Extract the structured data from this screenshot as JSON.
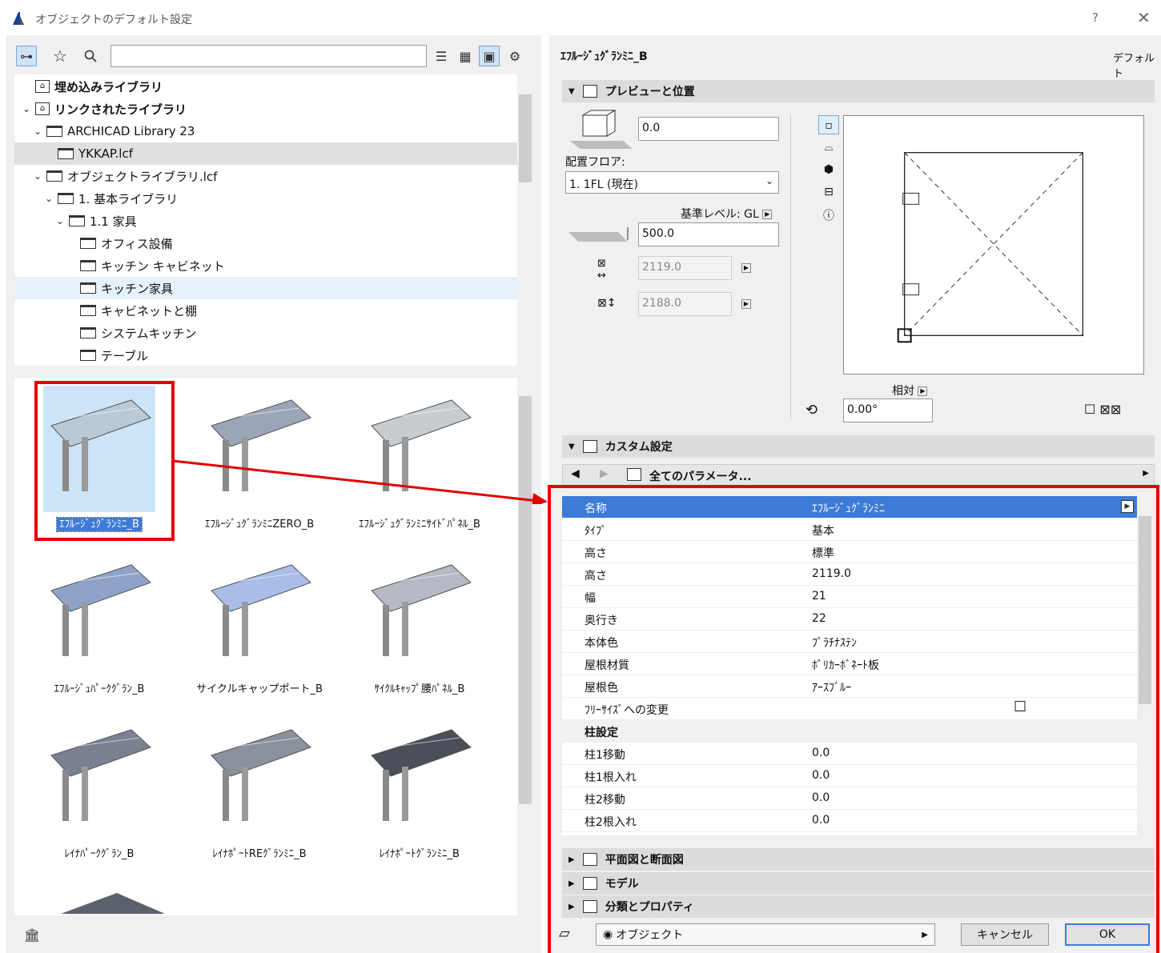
{
  "window": {
    "title": "オブジェクトのデフォルト設定",
    "help": "?",
    "close": "✕"
  },
  "search": {
    "value": "",
    "placeholder": ""
  },
  "tree": [
    {
      "label": "埋め込みライブラリ",
      "indent": 0,
      "chev": "",
      "icon": "lib",
      "bold": true
    },
    {
      "label": "リンクされたライブラリ",
      "indent": 0,
      "chev": "⌄",
      "icon": "lib",
      "bold": true
    },
    {
      "label": "ARCHICAD Library 23",
      "indent": 1,
      "chev": "⌄",
      "icon": "folder"
    },
    {
      "label": "YKKAP.lcf",
      "indent": 2,
      "chev": "",
      "icon": "folder",
      "state": "sel"
    },
    {
      "label": "オブジェクトライブラリ.lcf",
      "indent": 1,
      "chev": "⌄",
      "icon": "folder"
    },
    {
      "label": "1. 基本ライブラリ",
      "indent": 2,
      "chev": "⌄",
      "icon": "folder"
    },
    {
      "label": "1.1 家具",
      "indent": 3,
      "chev": "⌄",
      "icon": "folder"
    },
    {
      "label": "オフィス設備",
      "indent": 4,
      "chev": "",
      "icon": "folder"
    },
    {
      "label": "キッチン キャビネット",
      "indent": 4,
      "chev": "",
      "icon": "folder"
    },
    {
      "label": "キッチン家具",
      "indent": 4,
      "chev": "",
      "icon": "folder",
      "state": "hl"
    },
    {
      "label": "キャビネットと棚",
      "indent": 4,
      "chev": "",
      "icon": "folder"
    },
    {
      "label": "システムキッチン",
      "indent": 4,
      "chev": "",
      "icon": "folder"
    },
    {
      "label": "テーブル",
      "indent": 4,
      "chev": "",
      "icon": "folder"
    }
  ],
  "gallery": [
    {
      "label": "ｴﾌﾙｰｼﾞｭｸﾞﾗﾝﾐﾆ_B",
      "selected": true,
      "color": "#b9c9d6"
    },
    {
      "label": "ｴﾌﾙｰｼﾞｭｸﾞﾗﾝﾐﾆZERO_B",
      "selected": false,
      "color": "#9aa6b8"
    },
    {
      "label": "ｴﾌﾙｰｼﾞｭｸﾞﾗﾝﾐﾆｻｲﾄﾞﾊﾟﾈﾙ_B",
      "selected": false,
      "color": "#c8cbd0"
    },
    {
      "label": "ｴﾌﾙｰｼﾞｭﾊﾟｰｸｸﾞﾗﾝ_B",
      "selected": false,
      "color": "#8fa3c9"
    },
    {
      "label": "サイクルキャップポート_B",
      "selected": false,
      "color": "#a9bde8"
    },
    {
      "label": "ｻｲｸﾙｷｬｯﾌﾟ腰ﾊﾟﾈﾙ_B",
      "selected": false,
      "color": "#b4b9c4"
    },
    {
      "label": "ﾚｲﾅﾊﾟｰｸｸﾞﾗﾝ_B",
      "selected": false,
      "color": "#7a8190"
    },
    {
      "label": "ﾚｲﾅﾎﾟｰﾄREｸﾞﾗﾝﾐﾆ_B",
      "selected": false,
      "color": "#8a909c"
    },
    {
      "label": "ﾚｲﾅﾎﾟｰﾄｸﾞﾗﾝﾐﾆ_B",
      "selected": false,
      "color": "#4a4f5a"
    }
  ],
  "right": {
    "object_name": "ｴﾌﾙｰｼﾞｭｸﾞﾗﾝﾐﾆ_B",
    "default_label": "デフォルト",
    "sections": {
      "preview": "プレビューと位置",
      "custom": "カスタム設定",
      "plan": "平面図と断面図",
      "model": "モデル",
      "classify": "分類とプロパティ"
    },
    "offset_value": "0.0",
    "floor_label": "配置フロア:",
    "floor_value": "1. 1FL (現在)",
    "ref_level_label": "基準レベル: GL",
    "elev_value": "500.0",
    "width_value": "2119.0",
    "depth_value": "2188.0",
    "relative_label": "相対",
    "angle_value": "0.00°",
    "all_params": "全てのパラメータ...",
    "params": [
      {
        "name": "名称",
        "value": "ｴﾌﾙｰｼﾞｭｸﾞﾗﾝﾐﾆ",
        "type": "sel"
      },
      {
        "name": "ﾀｲﾌﾟ",
        "value": "基本"
      },
      {
        "name": "高さ",
        "value": "標準"
      },
      {
        "name": "高さ",
        "value": "2119.0"
      },
      {
        "name": "幅",
        "value": "21"
      },
      {
        "name": "奥行き",
        "value": "22"
      },
      {
        "name": "本体色",
        "value": "ﾌﾟﾗﾁﾅｽﾃﾝ"
      },
      {
        "name": "屋根材質",
        "value": "ﾎﾟﾘｶｰﾎﾞﾈｰﾄ板"
      },
      {
        "name": "屋根色",
        "value": "ｱｰｽﾌﾞﾙｰ"
      },
      {
        "name": "ﾌﾘｰｻｲｽﾞへの変更",
        "value": "☐",
        "type": "check"
      },
      {
        "name": "柱設定",
        "value": "",
        "type": "group"
      },
      {
        "name": "柱1移動",
        "value": "0.0"
      },
      {
        "name": "柱1根入れ",
        "value": "0.0"
      },
      {
        "name": "柱2移動",
        "value": "0.0"
      },
      {
        "name": "柱2根入れ",
        "value": "0.0"
      }
    ],
    "layer_value": "オブジェクト",
    "cancel": "キャンセル",
    "ok": "OK"
  }
}
